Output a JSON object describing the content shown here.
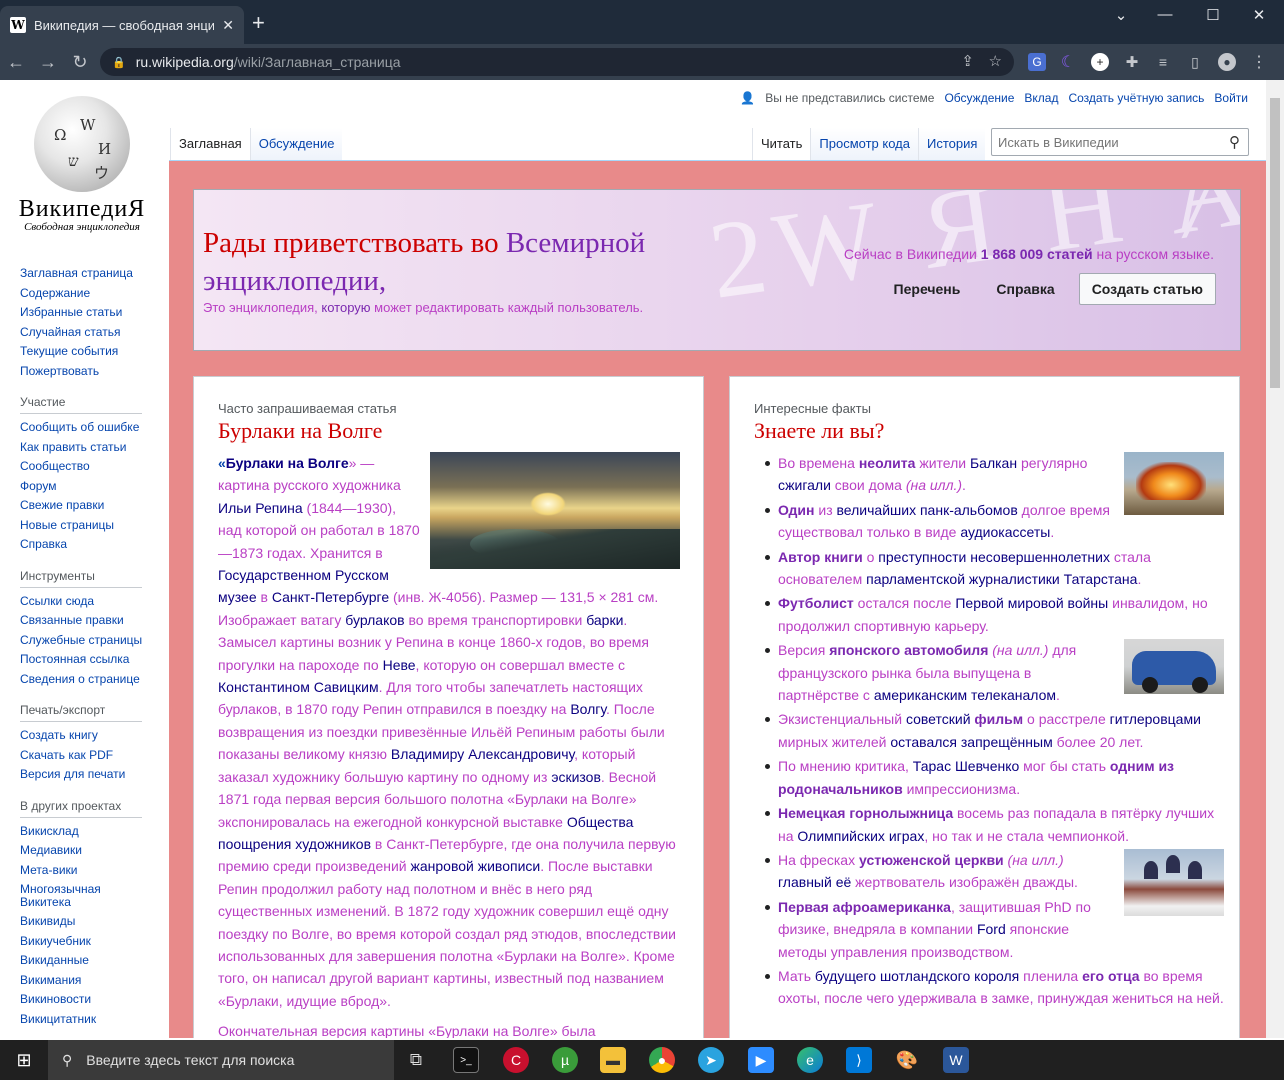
{
  "browser": {
    "tab_title": "Википедия — свободная энцик",
    "tab_close": "✕",
    "new_tab": "+",
    "url_host": "ru.wikipedia.org",
    "url_path": "/wiki/Заглавная_страница",
    "window_controls": {
      "collapse": "⌄",
      "minimize": "—",
      "maximize": "☐",
      "close": "✕"
    },
    "nav_icons": [
      "back-icon",
      "forward-icon",
      "reload-icon"
    ]
  },
  "personal": {
    "not_logged": "Вы не представились системе",
    "talk": "Обсуждение",
    "contributions": "Вклад",
    "create_account": "Создать учётную запись",
    "login": "Войти"
  },
  "logo": {
    "wordmark": "ВикипедиЯ",
    "tagline": "Свободная энциклопедия"
  },
  "tabs": {
    "main": "Заглавная",
    "discussion": "Обсуждение",
    "read": "Читать",
    "view_source": "Просмотр кода",
    "history": "История"
  },
  "search": {
    "placeholder": "Искать в Википедии"
  },
  "sidebar": {
    "nav": [
      "Заглавная страница",
      "Содержание",
      "Избранные статьи",
      "Случайная статья",
      "Текущие события",
      "Пожертвовать"
    ],
    "participation_head": "Участие",
    "participation": [
      "Сообщить об ошибке",
      "Как править статьи",
      "Сообщество",
      "Форум",
      "Свежие правки",
      "Новые страницы",
      "Справка"
    ],
    "tools_head": "Инструменты",
    "tools": [
      "Ссылки сюда",
      "Связанные правки",
      "Служебные страницы",
      "Постоянная ссылка",
      "Сведения о странице"
    ],
    "print_head": "Печать/экспорт",
    "print": [
      "Создать книгу",
      "Скачать как PDF",
      "Версия для печати"
    ],
    "projects_head": "В других проектах",
    "projects": [
      "Викисклад",
      "Медиавики",
      "Мета-вики",
      "Многоязычная Викитека",
      "Викивиды",
      "Викиучебник",
      "Викиданные",
      "Викимания",
      "Викиновости",
      "Викицитатник"
    ]
  },
  "banner": {
    "welcome_1": "Рады приветствовать во ",
    "welcome_link": "Всемирной",
    "welcome_2": "энциклопедии,",
    "subtitle_1": "Это энциклопедия, ",
    "subtitle_link": "которую",
    "subtitle_2": " может редактировать каждый пользователь.",
    "stats_1": "Сейчас в Википедии ",
    "stats_count": "1 868 009 статей",
    "stats_2": " на ",
    "stats_link": "русском языке",
    "stats_3": ".",
    "btn_list": "Перечень",
    "btn_help": "Справка",
    "btn_create": "Создать статью",
    "bg_letters": "2W Я H Ⱥ"
  },
  "featured": {
    "kicker": "Часто запрашиваемая статья",
    "title": "Бурлаки на Волге",
    "lead_quote_open": "«",
    "lead_bold": "Бурлаки на Волге",
    "lead_quote_close": "» — картина русского художника ",
    "artist": "Ильи Репина",
    "p1": " (1844—1930), над которой он работал в 1870—1873 годах. Хранится в ",
    "museum": "Государственном Русском музее",
    "p2": " в ",
    "spb": "Санкт-Петербурге",
    "p3": " (инв. Ж-4056). Размер — 131,5 × 281 см. Изображает ватагу ",
    "burlaks": "бурлаков",
    "p4": " во время транспортировки ",
    "barki": "барки",
    "p5": ". Замысел картины возник у Репина в конце 1860-х годов, во время прогулки на пароходе по ",
    "neva": "Неве",
    "p6": ", которую он совершал вместе с ",
    "savitsky": "Константином Савицким",
    "p7": ". Для того чтобы запечатлеть настоящих бурлаков, в 1870 году Репин отправился в поездку на ",
    "volga": "Волгу",
    "p8": ". После возвращения из поездки привезённые Ильёй Репиным работы были показаны великому князю ",
    "vladimir": "Владимиру Александровичу",
    "p9": ", который заказал художнику большую картину по одному из ",
    "sketches": "эскизов",
    "p10": ". Весной 1871 года первая версия большого полотна «Бурлаки на Волге» экспонировалась на ежегодной конкурсной выставке ",
    "society": "Общества поощрения художников",
    "p11": " в Санкт-Петербурге, где она получила первую премию среди произведений ",
    "genre": "жанровой живописи",
    "p12": ". После выставки Репин продолжил работу над полотном и внёс в него ряд существенных изменений. В 1872 году художник совершил ещё одну поездку по Волге, во время которой создал ряд этюдов, впоследствии использованных для завершения полотна «Бурлаки на Волге». Кроме того, он написал другой вариант картины, известный под названием «Бурлаки, идущие вброд».",
    "tail": "Окончательная версия картины «Бурлаки на Волге» была"
  },
  "dyk": {
    "kicker": "Интересные факты",
    "title": "Знаете ли вы?",
    "items": [
      {
        "a": "Во времена ",
        "b": "неолита",
        "c": " жители ",
        "d": "Балкан",
        "e": " регулярно ",
        "f": "сжигали",
        "g": " свои дома ",
        "h": "(на илл.)",
        "i": "."
      },
      {
        "a": "",
        "b": "Один",
        "c": " из ",
        "d": "величайших панк-альбомов",
        "e": " долгое время существовал только в виде ",
        "f": "аудиокассеты",
        "g": ".",
        "h": "",
        "i": ""
      },
      {
        "a": "",
        "b": "Автор книги",
        "c": " о ",
        "d": "преступности несовершеннолетних",
        "e": " стала основателем ",
        "f": "парламентской журналистики Татарстана",
        "g": ".",
        "h": "",
        "i": ""
      },
      {
        "a": "",
        "b": "Футболист",
        "c": " остался после ",
        "d": "Первой мировой войны",
        "e": " инвалидом, но продолжил спортивную карьеру.",
        "f": "",
        "g": "",
        "h": "",
        "i": ""
      },
      {
        "a": "Версия ",
        "b": "японского автомобиля",
        "c": " ",
        "d": "",
        "e": "для французского рынка была выпущена в партнёрстве с ",
        "f": "американским телеканалом",
        "g": ".",
        "h": "(на илл.)",
        "i": ""
      },
      {
        "a": "Экзистенциальный ",
        "b": "фильм",
        "c": " о расстреле ",
        "d": "гитлеровцами",
        "e": " мирных жителей ",
        "f": "оставался запрещённым",
        "g": " более 20 лет.",
        "h": "",
        "i": "",
        "pre": "советский"
      },
      {
        "a": "По мнению критика, ",
        "b": "одним из родоначальников",
        "c": " импрессионизма.",
        "d": "Тарас Шевченко",
        "e": " мог бы стать ",
        "f": "",
        "g": "",
        "h": "",
        "i": ""
      },
      {
        "a": "",
        "b": "Немецкая горнолыжница",
        "c": " восемь раз попадала в пятёрку лучших на ",
        "d": "Олимпийских играх",
        "e": ", но так и не стала чемпионкой.",
        "f": "",
        "g": "",
        "h": "",
        "i": ""
      },
      {
        "a": "На фресках ",
        "b": "устюженской церкви",
        "c": " ",
        "d": "главный её ",
        "e": "жертвователь",
        "f": " изображён дважды.",
        "g": "",
        "h": "(на илл.)",
        "i": ""
      },
      {
        "a": "",
        "b": "Первая афроамериканка",
        "c": ", защитившая PhD по физике, внедряла в компании ",
        "d": "Ford",
        "e": " японские методы управления производством.",
        "f": "",
        "g": "",
        "h": "",
        "i": ""
      },
      {
        "a": "Мать ",
        "b": "его отца",
        "c": " во время охоты, после чего удерживала в замке, принуждая жениться на ней.",
        "d": "будущего шотландского короля",
        "e": " пленила ",
        "f": "",
        "g": "",
        "h": "",
        "i": ""
      }
    ]
  },
  "taskbar": {
    "search_placeholder": "Введите здесь текст для поиска"
  },
  "colors": {
    "link": "#0645ad",
    "visited": "#7b28b0",
    "content_bg": "#e88a8a",
    "title_red": "#cc0000"
  }
}
